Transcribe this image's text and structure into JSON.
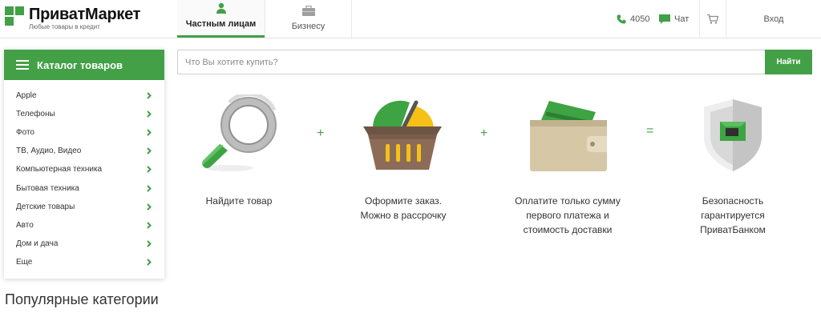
{
  "header": {
    "logo_title": "ПриватМаркет",
    "logo_subtitle": "Любые товары в кредит",
    "tabs": [
      {
        "label": "Частным лицам",
        "active": true
      },
      {
        "label": "Бизнесу",
        "active": false
      }
    ],
    "phone": "4050",
    "chat": "Чат",
    "login": "Вход"
  },
  "catalog": {
    "title": "Каталог товаров",
    "items": [
      {
        "label": "Apple"
      },
      {
        "label": "Телефоны"
      },
      {
        "label": "Фото"
      },
      {
        "label": "ТВ, Аудио, Видео"
      },
      {
        "label": "Компьютерная техника"
      },
      {
        "label": "Бытовая техника"
      },
      {
        "label": "Детские товары"
      },
      {
        "label": "Авто"
      },
      {
        "label": "Дом и дача"
      },
      {
        "label": "Еще"
      }
    ]
  },
  "search": {
    "placeholder": "Что Вы хотите купить?",
    "button_label": "Найти"
  },
  "steps": {
    "op_plus": "+",
    "op_equals": "=",
    "step1": {
      "line1": "Найдите товар"
    },
    "step2": {
      "line1": "Оформите заказ.",
      "line2": "Можно в рассрочку"
    },
    "step3": {
      "line1": "Оплатите только сумму",
      "line2": "первого платежа и",
      "line3": "стоимость доставки"
    },
    "step4": {
      "line1": "Безопасность",
      "line2": "гарантируется",
      "line3": "ПриватБанком"
    }
  },
  "popular_title": "Популярные категории",
  "colors": {
    "accent": "#43a047"
  }
}
